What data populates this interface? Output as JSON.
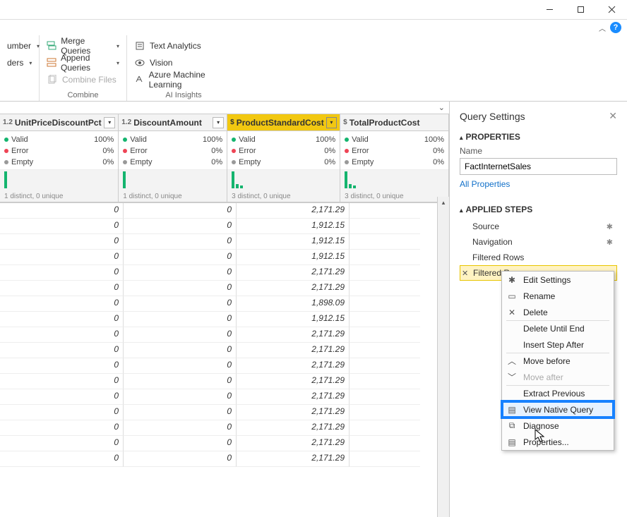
{
  "window": {
    "minimize_aria": "Minimize",
    "maximize_aria": "Maximize",
    "close_aria": "Close",
    "help_aria": "Help"
  },
  "ribbon": {
    "left": {
      "number_label": "umber",
      "ders_label": "ders"
    },
    "combine": {
      "merge": "Merge Queries",
      "append": "Append Queries",
      "combine_files": "Combine Files",
      "group_label": "Combine"
    },
    "ai": {
      "text_analytics": "Text Analytics",
      "vision": "Vision",
      "aml": "Azure Machine Learning",
      "group_label": "AI Insights"
    }
  },
  "columns": [
    {
      "name": "UnitPriceDiscountPct",
      "type": "1.2",
      "valid": "100%",
      "error": "0%",
      "empty": "0%",
      "distinct": "1 distinct, 0 unique",
      "bars": 1
    },
    {
      "name": "DiscountAmount",
      "type": "1.2",
      "valid": "100%",
      "error": "0%",
      "empty": "0%",
      "distinct": "1 distinct, 0 unique",
      "bars": 1
    },
    {
      "name": "ProductStandardCost",
      "type": "$",
      "valid": "100%",
      "error": "0%",
      "empty": "0%",
      "distinct": "3 distinct, 0 unique",
      "bars": 3,
      "highlight": true
    },
    {
      "name": "TotalProductCost",
      "type": "$",
      "valid": "100%",
      "error": "0%",
      "empty": "0%",
      "distinct": "3 distinct, 0 unique",
      "bars": 3
    }
  ],
  "profile_labels": {
    "valid": "Valid",
    "error": "Error",
    "empty": "Empty"
  },
  "rows": [
    {
      "upd": "0",
      "da": "0",
      "psc": "2,171.29"
    },
    {
      "upd": "0",
      "da": "0",
      "psc": "1,912.15"
    },
    {
      "upd": "0",
      "da": "0",
      "psc": "1,912.15"
    },
    {
      "upd": "0",
      "da": "0",
      "psc": "1,912.15"
    },
    {
      "upd": "0",
      "da": "0",
      "psc": "2,171.29"
    },
    {
      "upd": "0",
      "da": "0",
      "psc": "2,171.29"
    },
    {
      "upd": "0",
      "da": "0",
      "psc": "1,898.09"
    },
    {
      "upd": "0",
      "da": "0",
      "psc": "1,912.15"
    },
    {
      "upd": "0",
      "da": "0",
      "psc": "2,171.29"
    },
    {
      "upd": "0",
      "da": "0",
      "psc": "2,171.29"
    },
    {
      "upd": "0",
      "da": "0",
      "psc": "2,171.29"
    },
    {
      "upd": "0",
      "da": "0",
      "psc": "2,171.29"
    },
    {
      "upd": "0",
      "da": "0",
      "psc": "2,171.29"
    },
    {
      "upd": "0",
      "da": "0",
      "psc": "2,171.29"
    },
    {
      "upd": "0",
      "da": "0",
      "psc": "2,171.29"
    },
    {
      "upd": "0",
      "da": "0",
      "psc": "2,171.29"
    },
    {
      "upd": "0",
      "da": "0",
      "psc": "2,171.29"
    }
  ],
  "side": {
    "title": "Query Settings",
    "properties_header": "PROPERTIES",
    "name_label": "Name",
    "name_value": "FactInternetSales",
    "all_props": "All Properties",
    "steps_header": "APPLIED STEPS",
    "steps": [
      {
        "label": "Source",
        "gear": true
      },
      {
        "label": "Navigation",
        "gear": true
      },
      {
        "label": "Filtered Rows",
        "gear": false
      },
      {
        "label": "Filtered R...",
        "gear": false,
        "selected": true
      }
    ]
  },
  "context_menu": [
    {
      "label": "Edit Settings",
      "icon": "gear"
    },
    {
      "label": "Rename",
      "icon": "rename"
    },
    {
      "label": "Delete",
      "icon": "x",
      "sep": true
    },
    {
      "label": "Delete Until End"
    },
    {
      "label": "Insert Step After",
      "sep": true
    },
    {
      "label": "Move before",
      "icon": "up"
    },
    {
      "label": "Move after",
      "icon": "down",
      "disabled": true,
      "sep": true
    },
    {
      "label": "Extract Previous",
      "sep": true
    },
    {
      "label": "View Native Query",
      "icon": "doc",
      "highlighted": true
    },
    {
      "label": "Diagnose",
      "icon": "diag"
    },
    {
      "label": "Properties...",
      "icon": "props"
    }
  ]
}
